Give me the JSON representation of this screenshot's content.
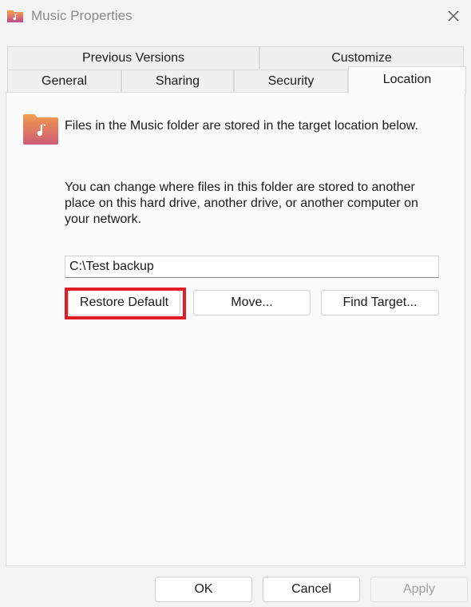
{
  "window": {
    "title": "Music Properties",
    "title_icon": "music-folder-icon",
    "close_icon": "close-icon"
  },
  "tabs": {
    "row1": [
      {
        "label": "Previous Versions"
      },
      {
        "label": "Customize"
      }
    ],
    "row2": [
      {
        "label": "General"
      },
      {
        "label": "Sharing"
      },
      {
        "label": "Security"
      },
      {
        "label": "Location",
        "active": true
      }
    ]
  },
  "location": {
    "folder_icon": "music-folder-icon",
    "description": "Files in the Music folder are stored in the target location below.",
    "help_text": "You can change where files in this folder are stored to another place on this hard drive, another drive, or another computer on your network.",
    "path_value": "C:\\Test backup",
    "buttons": {
      "restore": "Restore Default",
      "move": "Move...",
      "find": "Find Target..."
    }
  },
  "footer": {
    "ok": "OK",
    "cancel": "Cancel",
    "apply": "Apply"
  },
  "colors": {
    "highlight": "#e11d27",
    "folder_top": "#f4a24c",
    "folder_bottom": "#c04a8a"
  }
}
